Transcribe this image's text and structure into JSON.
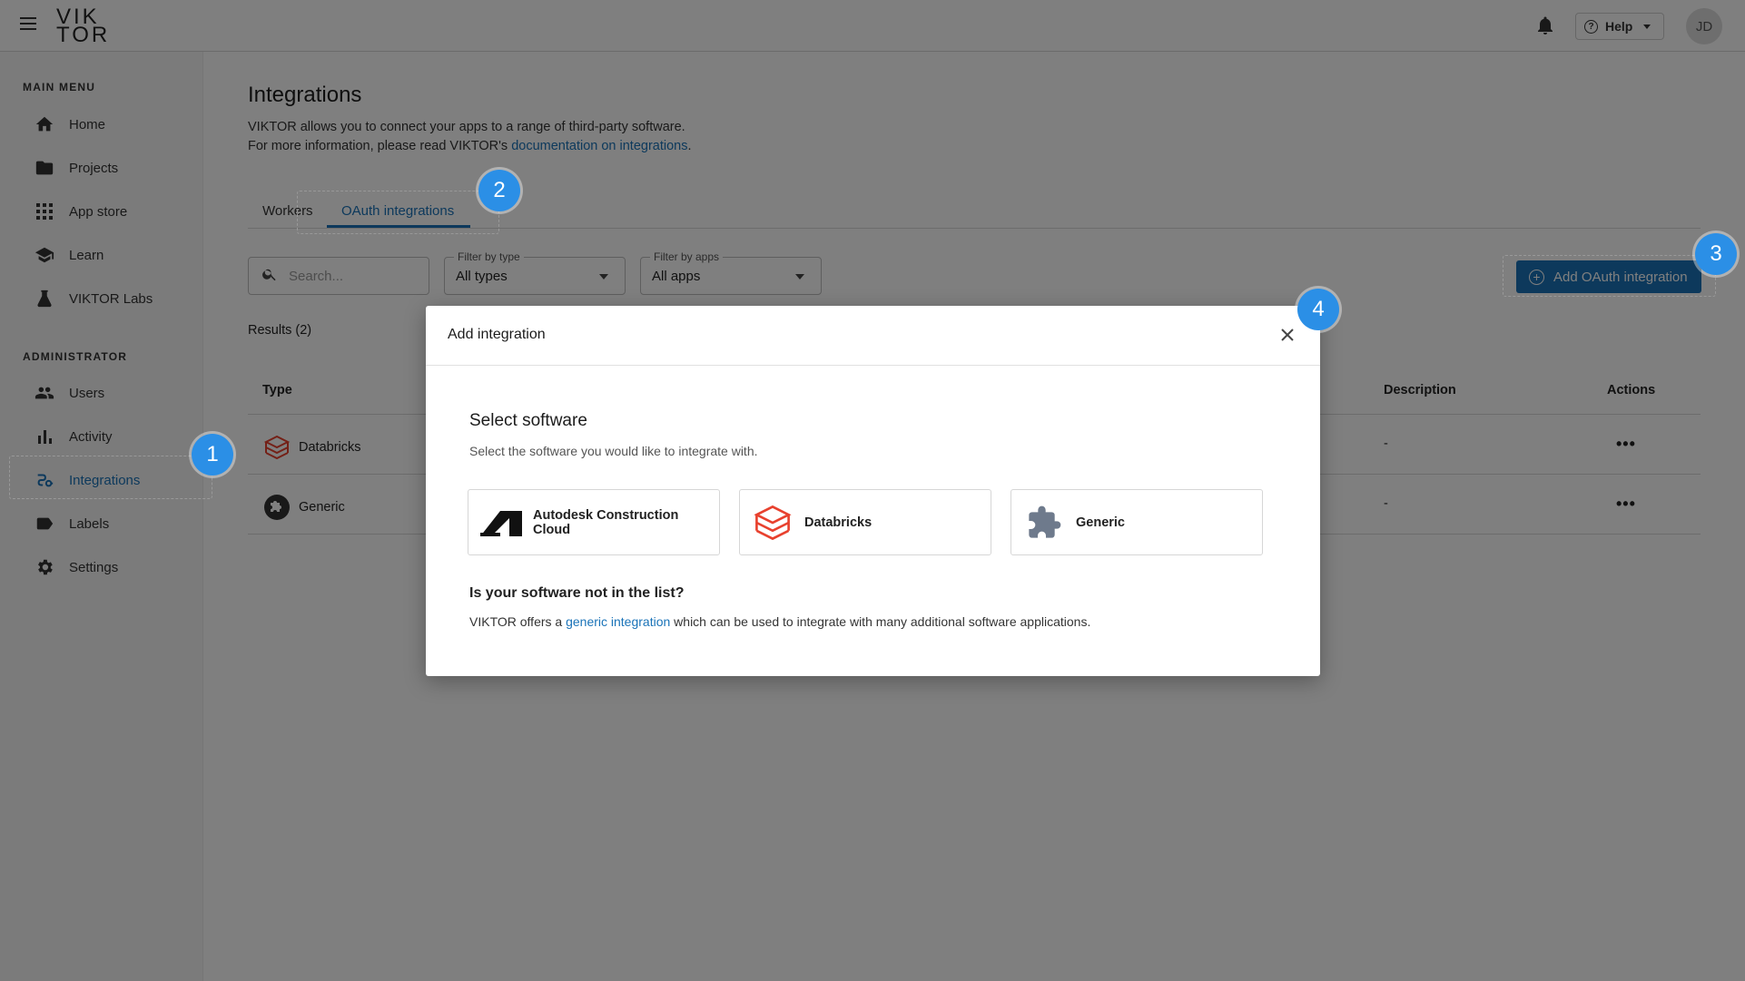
{
  "topbar": {
    "logo_line1": "VIK",
    "logo_line2": "TOR",
    "help_label": "Help",
    "avatar_initials": "JD"
  },
  "sidebar": {
    "main_menu_title": "MAIN MENU",
    "main_items": [
      {
        "label": "Home",
        "icon": "home-icon"
      },
      {
        "label": "Projects",
        "icon": "folder-icon"
      },
      {
        "label": "App store",
        "icon": "grid-icon"
      },
      {
        "label": "Learn",
        "icon": "graduation-cap-icon"
      },
      {
        "label": "VIKTOR Labs",
        "icon": "flask-icon"
      }
    ],
    "admin_title": "ADMINISTRATOR",
    "admin_items": [
      {
        "label": "Users",
        "icon": "users-icon"
      },
      {
        "label": "Activity",
        "icon": "bar-chart-icon"
      },
      {
        "label": "Integrations",
        "icon": "integrations-icon",
        "active": true
      },
      {
        "label": "Labels",
        "icon": "label-icon"
      },
      {
        "label": "Settings",
        "icon": "gear-icon"
      }
    ]
  },
  "page": {
    "title": "Integrations",
    "desc_line1": "VIKTOR allows you to connect your apps to a range of third-party software.",
    "desc_line2_prefix": "For more information, please read VIKTOR's ",
    "desc_link": "documentation on integrations",
    "desc_line2_suffix": "."
  },
  "tabs": [
    {
      "label": "Workers",
      "active": false
    },
    {
      "label": "OAuth integrations",
      "active": true
    }
  ],
  "filters": {
    "search_placeholder": "Search...",
    "type_label": "Filter by type",
    "type_value": "All types",
    "apps_label": "Filter by apps",
    "apps_value": "All apps"
  },
  "add_button_label": "Add OAuth integration",
  "results_label": "Results (2)",
  "table": {
    "columns": [
      "Type",
      "Description",
      "Actions"
    ],
    "rows": [
      {
        "type": "Databricks",
        "description": "-",
        "actions": "•••"
      },
      {
        "type": "Generic",
        "description": "-",
        "actions": "•••"
      }
    ]
  },
  "modal": {
    "title": "Add integration",
    "heading": "Select software",
    "subheading": "Select the software you would like to integrate with.",
    "options": [
      {
        "label": "Autodesk Construction Cloud",
        "icon": "autodesk-icon"
      },
      {
        "label": "Databricks",
        "icon": "databricks-icon"
      },
      {
        "label": "Generic",
        "icon": "puzzle-icon"
      }
    ],
    "not_listed_heading": "Is your software not in the list?",
    "not_listed_prefix": "VIKTOR offers a ",
    "not_listed_link": "generic integration",
    "not_listed_suffix": " which can be used to integrate with many additional software applications."
  },
  "badges": [
    "1",
    "2",
    "3",
    "4"
  ],
  "colors": {
    "accent": "#1a73b8",
    "badge": "#2b8fe6",
    "databricks": "#e8412e"
  }
}
